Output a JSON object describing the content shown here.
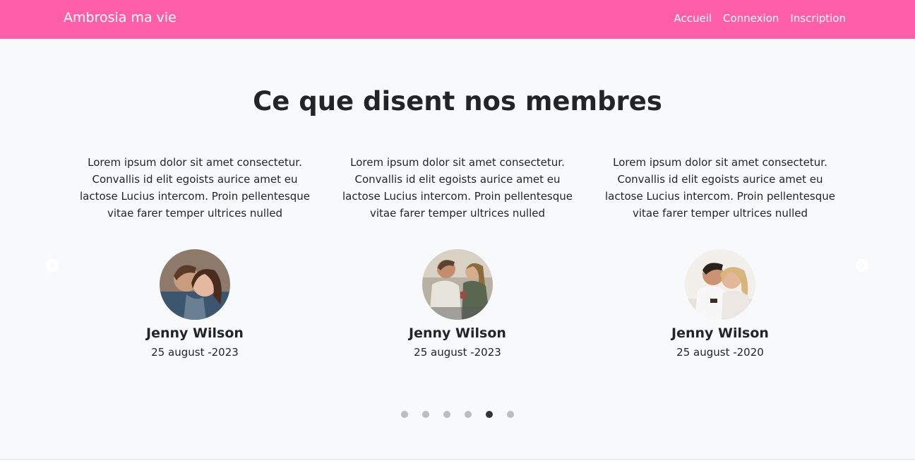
{
  "navbar": {
    "brand": "Ambrosia ma vie",
    "links": [
      "Accueil",
      "Connexion",
      "Inscription"
    ],
    "background": "#ff5fa8"
  },
  "section": {
    "title": "Ce que disent nos membres"
  },
  "testimonials": [
    {
      "quote": "Lorem ipsum dolor sit amet consectetur. Convallis id elit egoists aurice amet eu lactose Lucius intercom. Proin pellentesque vitae farer temper ultrices nulled",
      "name": "Jenny Wilson",
      "date": "25 august -2023"
    },
    {
      "quote": "Lorem ipsum dolor sit amet consectetur. Convallis id elit egoists aurice amet eu lactose Lucius intercom. Proin pellentesque vitae farer temper ultrices nulled",
      "name": "Jenny Wilson",
      "date": "25 august -2023"
    },
    {
      "quote": "Lorem ipsum dolor sit amet consectetur. Convallis id elit egoists aurice amet eu lactose Lucius intercom. Proin pellentesque vitae farer temper ultrices nulled",
      "name": "Jenny Wilson",
      "date": "25 august -2020"
    }
  ],
  "carousel": {
    "prev_icon": "chevron-left-icon",
    "next_icon": "chevron-right-icon",
    "slide_count": 6,
    "active_index": 4
  }
}
